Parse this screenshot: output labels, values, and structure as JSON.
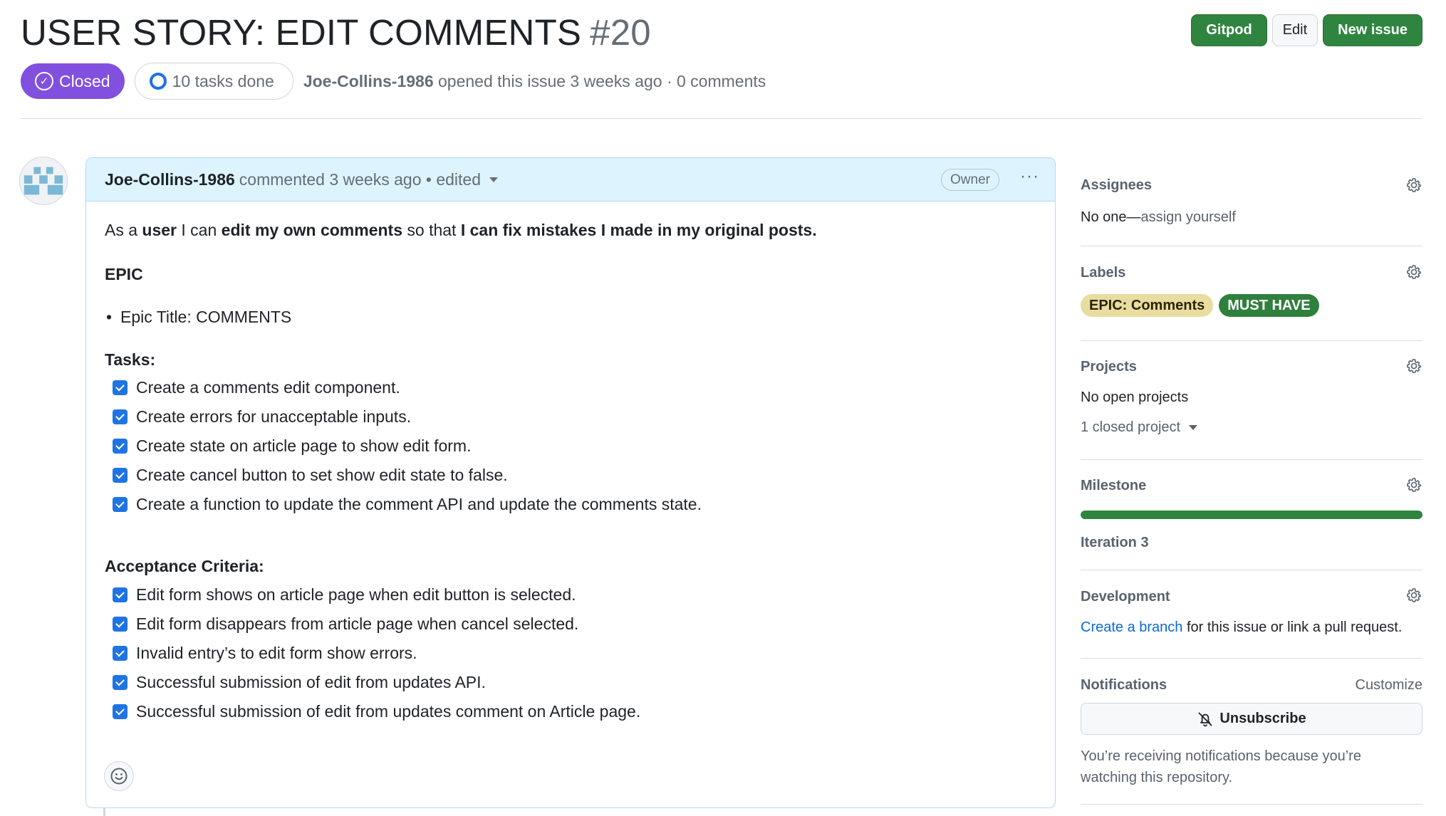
{
  "header": {
    "title": "USER STORY: EDIT COMMENTS",
    "number": "#20",
    "buttons": {
      "gitpod": "Gitpod",
      "edit": "Edit",
      "new_issue": "New issue"
    },
    "state": "Closed",
    "tasks_done": "10 tasks done",
    "author": "Joe-Collins-1986",
    "opened_text": "opened this issue 3 weeks ago · 0 comments"
  },
  "comment": {
    "author": "Joe-Collins-1986",
    "meta": "commented 3 weeks ago • edited",
    "role": "Owner",
    "story": {
      "t1": "As a ",
      "b1": "user",
      "t2": " I can ",
      "b2": "edit my own comments",
      "t3": " so that ",
      "b3": "I can fix mistakes I made in my original posts."
    },
    "epic_heading": "EPIC",
    "epic_item": "Epic Title: COMMENTS",
    "tasks_heading": "Tasks:",
    "tasks": [
      "Create a comments edit component.",
      "Create errors for unacceptable inputs.",
      "Create state on article page to show edit form.",
      "Create cancel button to set show edit state to false.",
      "Create a function to update the comment API and update the comments state."
    ],
    "acceptance_heading": "Acceptance Criteria:",
    "acceptance": [
      "Edit form shows on article page when edit button is selected.",
      "Edit form disappears from article page when cancel selected.",
      "Invalid entry’s to edit form show errors.",
      "Successful submission of edit from updates API.",
      "Successful submission of edit from updates comment on Article page."
    ]
  },
  "sidebar": {
    "assignees": {
      "title": "Assignees",
      "none": "No one—",
      "assign": "assign yourself"
    },
    "labels": {
      "title": "Labels",
      "items": [
        "EPIC: Comments",
        "MUST HAVE"
      ],
      "colors": [
        "#e8dda0",
        "#2f7f3d"
      ]
    },
    "projects": {
      "title": "Projects",
      "open": "No open projects",
      "closed": "1 closed project"
    },
    "milestone": {
      "title": "Milestone",
      "name": "Iteration 3",
      "progress": 1.0
    },
    "development": {
      "title": "Development",
      "link": "Create a branch",
      "rest": " for this issue or link a pull request."
    },
    "notifications": {
      "title": "Notifications",
      "customize": "Customize",
      "unsubscribe": "Unsubscribe",
      "reason": "You’re receiving notifications because you’re watching this repository."
    }
  },
  "colors": {
    "accent_green": "#2f8540",
    "closed_purple": "#8250df",
    "link_blue": "#0969da"
  }
}
